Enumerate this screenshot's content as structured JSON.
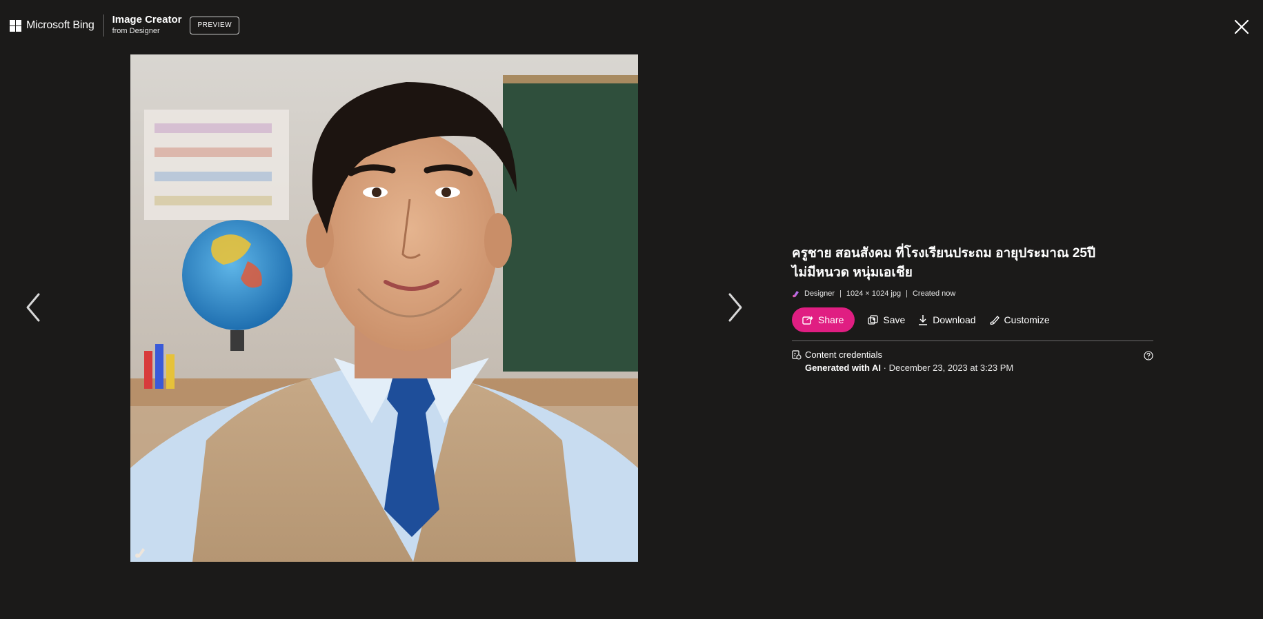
{
  "header": {
    "brand": "Microsoft Bing",
    "product_title": "Image Creator",
    "product_subtitle": "from Designer",
    "badge": "PREVIEW"
  },
  "icons": {
    "close": "close-icon",
    "prev": "chevron-left-icon",
    "next": "chevron-right-icon",
    "share": "share-icon",
    "save": "save-collection-icon",
    "download": "download-icon",
    "customize": "paintbrush-icon",
    "credentials": "content-credentials-icon",
    "help": "help-circle-icon",
    "designer": "designer-logo-icon"
  },
  "image": {
    "alt": "ครูชาย สอนสังคม ที่โรงเรียนประถม อายุประมาณ 25ปี ไม่มีหนวด หนุ่มเอเชีย"
  },
  "details": {
    "prompt_line1": "ครูชาย สอนสังคม ที่โรงเรียนประถม อายุประมาณ 25ปี",
    "prompt_line2": "ไม่มีหนวด หนุ่มเอเชีย",
    "meta_source": "Designer",
    "meta_size": "1024 × 1024 jpg",
    "meta_created": "Created now",
    "separator": "|"
  },
  "actions": {
    "share": "Share",
    "save": "Save",
    "download": "Download",
    "customize": "Customize"
  },
  "credentials": {
    "title": "Content credentials",
    "generated": "Generated with AI",
    "date": " · December 23, 2023 at 3:23 PM"
  },
  "colors": {
    "background": "#1b1a19",
    "share_accent": "#e01e82",
    "text": "#ffffff"
  }
}
